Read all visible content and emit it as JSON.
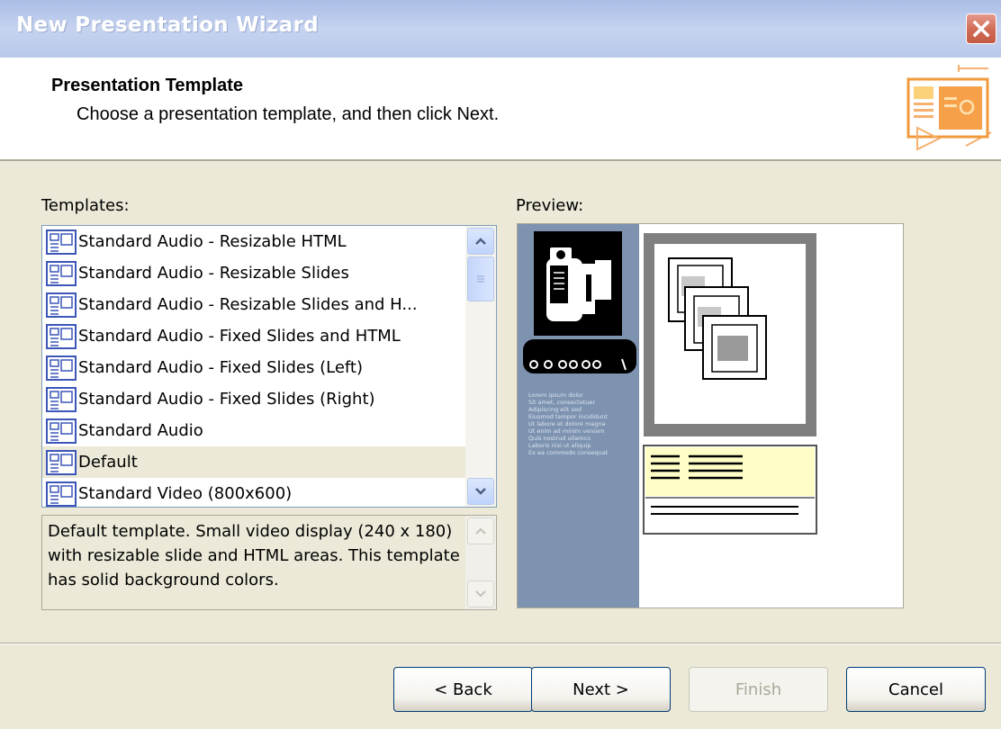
{
  "window": {
    "title": "New Presentation Wizard",
    "close_icon": "close-icon"
  },
  "header": {
    "title": "Presentation Template",
    "subtitle": "Choose a presentation template, and then click Next.",
    "icon": "presentation-icon"
  },
  "templates": {
    "label": "Templates:",
    "items": [
      "Standard Audio - Resizable HTML",
      "Standard Audio - Resizable Slides",
      "Standard Audio - Resizable Slides and H...",
      "Standard Audio - Fixed Slides and HTML",
      "Standard Audio - Fixed Slides (Left)",
      "Standard Audio - Fixed Slides (Right)",
      "Standard Audio",
      "Default",
      "Standard Video (800x600)"
    ],
    "selected": "Default",
    "description": "Default template. Small video display (240 x 180) with resizable slide and HTML areas. This template has solid background colors."
  },
  "preview": {
    "label": "Preview:",
    "sample_text": "Lorem ipsum dolor Sit amet, consectetuer Adipiscing elit sed Eiusmod tempor incididunt Ut labore et dolore magna Ut enim ad minim veniam Quis nostrud ullamco Laboris nisi ut aliquip Ex ea commodo consequat",
    "colors": {
      "sidebar": "#7d93b0",
      "panel": "#fefec6",
      "frame": "#7f7f7f"
    }
  },
  "buttons": {
    "back": "< Back",
    "next": "Next >",
    "finish": "Finish",
    "cancel": "Cancel"
  },
  "colors": {
    "dialog_bg": "#ece9d8",
    "titlebar": "#b9c9ec",
    "close": "#c45a44",
    "scroll_button": "#c0d3fb"
  }
}
